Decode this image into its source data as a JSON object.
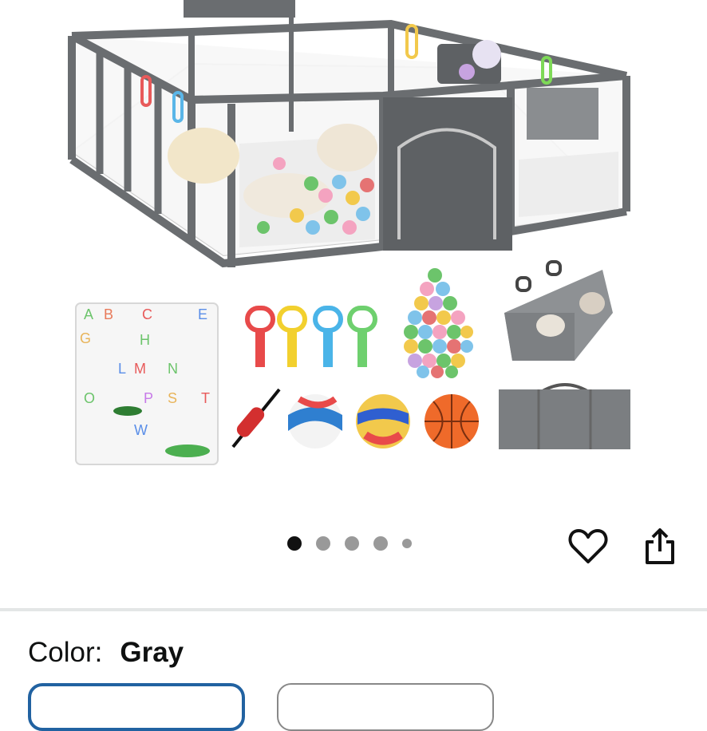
{
  "product_image": {
    "alt_icon": "playpen-product-image",
    "carousel": {
      "total": 5,
      "active_index": 0
    }
  },
  "actions": {
    "wishlist_icon": "heart-icon",
    "share_icon": "share-icon"
  },
  "color": {
    "label": "Color:",
    "value": "Gray"
  },
  "variants": {
    "selected_border": "#2162a1",
    "other_border": "#888888"
  }
}
